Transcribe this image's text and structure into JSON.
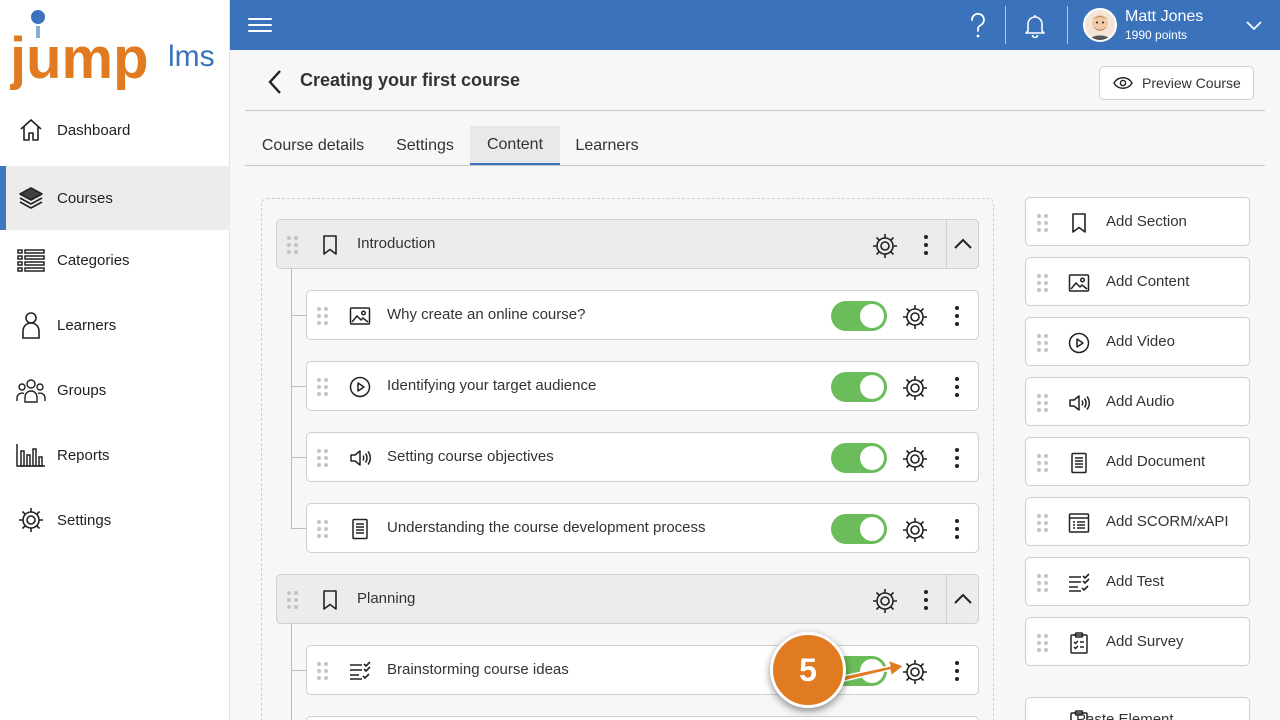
{
  "brand": {
    "logo_text_main": "jump",
    "logo_text_suffix": "lms",
    "accent": "#3a72bb",
    "logo_orange": "#e07b22",
    "logo_blue": "#3a72bb"
  },
  "sidebar": {
    "items": [
      {
        "label": "Dashboard",
        "icon": "house-icon",
        "active": false
      },
      {
        "label": "Courses",
        "icon": "books-icon",
        "active": true
      },
      {
        "label": "Categories",
        "icon": "list-icon",
        "active": false
      },
      {
        "label": "Learners",
        "icon": "person-icon",
        "active": false
      },
      {
        "label": "Groups",
        "icon": "group-icon",
        "active": false
      },
      {
        "label": "Reports",
        "icon": "bar-chart-icon",
        "active": false
      },
      {
        "label": "Settings",
        "icon": "gear-icon",
        "active": false
      }
    ]
  },
  "topbar": {
    "user_name": "Matt Jones",
    "user_points": "1990 points"
  },
  "header": {
    "title": "Creating your first course",
    "preview_label": "Preview Course"
  },
  "tabs": [
    {
      "label": "Course details",
      "active": false
    },
    {
      "label": "Settings",
      "active": false
    },
    {
      "label": "Content",
      "active": true
    },
    {
      "label": "Learners",
      "active": false
    }
  ],
  "content": {
    "sections": [
      {
        "title": "Introduction",
        "items": [
          {
            "title": "Why create an online course?",
            "type": "image-icon",
            "enabled": true
          },
          {
            "title": "Identifying your target audience",
            "type": "play-icon",
            "enabled": true
          },
          {
            "title": "Setting course objectives",
            "type": "speaker-icon",
            "enabled": true
          },
          {
            "title": "Understanding the course development process",
            "type": "document-icon",
            "enabled": true
          }
        ]
      },
      {
        "title": "Planning",
        "items": [
          {
            "title": "Brainstorming course ideas",
            "type": "checklist-icon",
            "enabled": true
          }
        ]
      }
    ]
  },
  "add_panel": {
    "items": [
      {
        "label": "Add Section",
        "icon": "bookmark-icon"
      },
      {
        "label": "Add Content",
        "icon": "image-icon"
      },
      {
        "label": "Add Video",
        "icon": "play-icon"
      },
      {
        "label": "Add Audio",
        "icon": "speaker-icon"
      },
      {
        "label": "Add Document",
        "icon": "document-icon"
      },
      {
        "label": "Add SCORM/xAPI",
        "icon": "scorm-icon"
      },
      {
        "label": "Add Test",
        "icon": "checklist-icon"
      },
      {
        "label": "Add Survey",
        "icon": "clipboard-icon"
      },
      {
        "label": "Paste Element",
        "icon": "paste-icon"
      }
    ]
  },
  "step_marker": {
    "number": "5",
    "color": "#e07b22"
  }
}
